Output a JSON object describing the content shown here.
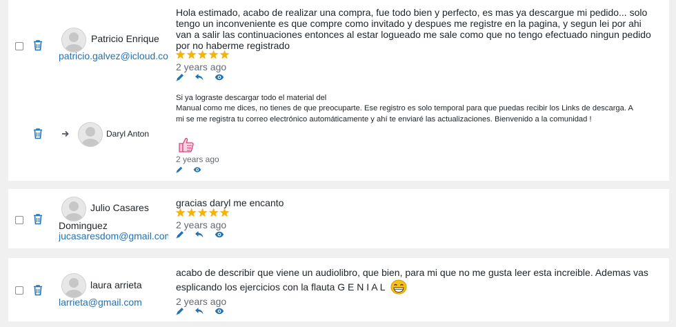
{
  "comments": [
    {
      "author_lines": [
        "Patricio Enrique"
      ],
      "email": "patricio.galvez@icloud.com",
      "message": "Hola estimado, acabo de realizar una compra, fue todo bien y perfecto, es mas ya descargue mi pedido... solo tengo un inconveniente es que compre como invitado y despues me registre en la pagina, y segun lei por ahi van a salir las continuaciones entonces al estar logueado me sale como que no tengo efectuado ningun pedido por no haberme registrado",
      "rating": 5,
      "time_ago": "2 years ago",
      "reply": {
        "author": "Daryl Anton",
        "message_lines": [
          "Si ya lograste descargar todo el material del",
          "Manual como me dices, no tienes de que preocuparte. Ese registro es solo temporal para que puedas recibir los Links de descarga. A mi se me registra tu correo electrónico automáticamente y ahí te enviaré las actualizaciones. Bienvenido a la comunidad !"
        ],
        "emoji": "thumbs-up-icon",
        "time_ago": "2 years ago"
      }
    },
    {
      "author_lines": [
        "Julio Casares",
        "Dominguez"
      ],
      "email": "jucasaresdom@gmail.com",
      "message": "gracias daryl me encanto",
      "rating": 5,
      "time_ago": "2 years ago"
    },
    {
      "author_lines": [
        "laura arrieta"
      ],
      "email": "larrieta@gmail.com",
      "message": "acabo de describir que viene un audiolibro, que bien, para mi que no me gusta leer esta increible. Ademas vas esplicando los ejercicios con la flauta G E N I A L",
      "emoji": "grinning-face-icon",
      "time_ago": "2 years ago"
    }
  ],
  "colors": {
    "link": "#2271b1",
    "star": "#f5b400",
    "background": "#f0f0f1"
  }
}
